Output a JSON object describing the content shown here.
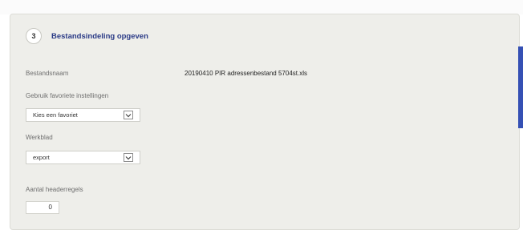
{
  "step": {
    "number": "3",
    "title": "Bestandsindeling opgeven"
  },
  "file": {
    "label": "Bestandsnaam",
    "value": "20190410 PIR adressenbestand 5704st.xls"
  },
  "favorite": {
    "label": "Gebruik favoriete instellingen",
    "selected": "Kies een favoriet"
  },
  "sheet": {
    "label": "Werkblad",
    "selected": "export"
  },
  "header_rows": {
    "label": "Aantal headerregels",
    "value": "0"
  },
  "colors": {
    "accent": "#2a3a86",
    "scroll_accent": "#3550b4",
    "panel_bg": "#eeeeea"
  }
}
